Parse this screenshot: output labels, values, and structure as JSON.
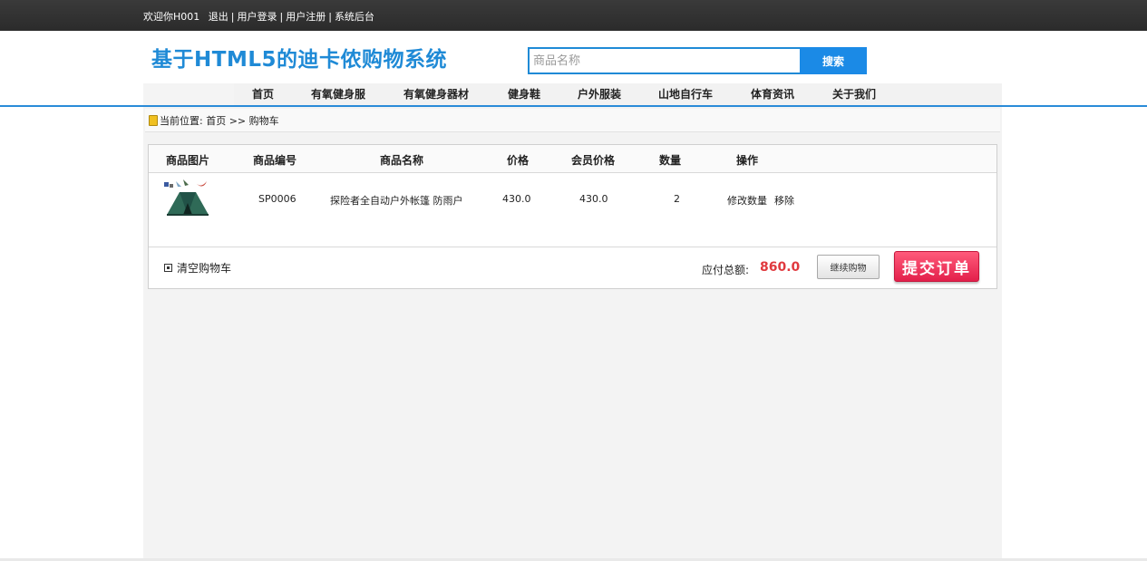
{
  "topbar": {
    "welcome": "欢迎你H001",
    "logout": "退出",
    "login": "用户登录",
    "register": "用户注册",
    "admin": "系统后台",
    "separator": "|"
  },
  "header": {
    "site_title": "基于HTML5的迪卡侬购物系统",
    "search_placeholder": "商品名称",
    "search_button": "搜索"
  },
  "nav": {
    "items": [
      "首页",
      "有氧健身服",
      "有氧健身器材",
      "健身鞋",
      "户外服装",
      "山地自行车",
      "体育资讯",
      "关于我们"
    ]
  },
  "breadcrumb": {
    "prefix": "当前位置:",
    "home": "首页",
    "arrow": ">>",
    "current": "购物车"
  },
  "cart": {
    "columns": [
      "商品图片",
      "商品编号",
      "商品名称",
      "价格",
      "会员价格",
      "数量",
      "操作"
    ],
    "rows": [
      {
        "image_icon": "tent-product-image",
        "code": "SP0006",
        "name": "探险者全自动户外帐篷 防雨户",
        "price": "430.0",
        "member_price": "430.0",
        "quantity": "2",
        "edit_action": "修改数量",
        "remove_action": "移除"
      }
    ],
    "clear_cart": "清空购物车",
    "total_label": "应付总额:",
    "total_value": "860.0",
    "continue_button": "继续购物",
    "submit_button": "提交订单"
  },
  "colors": {
    "brand_blue": "#1f8ad6",
    "total_red": "#e0393e",
    "submit_red": "#e3204b"
  }
}
